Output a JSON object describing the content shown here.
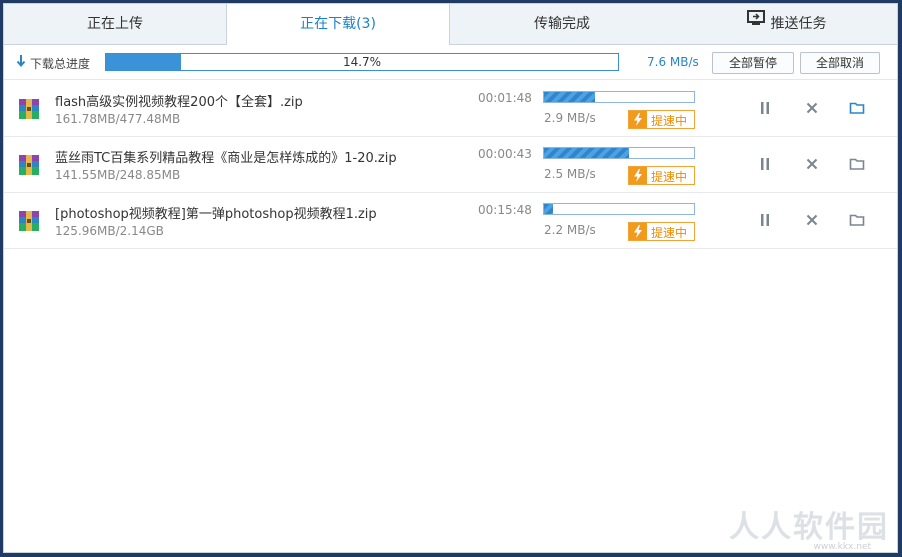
{
  "tabs": [
    {
      "label": "正在上传"
    },
    {
      "label": "正在下载(3)"
    },
    {
      "label": "传输完成"
    },
    {
      "label": "推送任务",
      "icon": "monitor-push-icon"
    }
  ],
  "total": {
    "label": "下载总进度",
    "progress_text": "14.7%",
    "progress": 0.147,
    "speed": "7.6 MB/s",
    "pause_all": "全部暂停",
    "cancel_all": "全部取消"
  },
  "downloads": [
    {
      "name": "flash高级实例视频教程200个【全套】.zip",
      "size": "161.78MB/477.48MB",
      "time": "00:01:48",
      "speed": "2.9 MB/s",
      "progress": 0.339,
      "boost": "提速中"
    },
    {
      "name": "蓝丝雨TC百集系列精品教程《商业是怎样炼成的》1-20.zip",
      "size": "141.55MB/248.85MB",
      "time": "00:00:43",
      "speed": "2.5 MB/s",
      "progress": 0.569,
      "boost": "提速中"
    },
    {
      "name": "[photoshop视频教程]第一弹photoshop视频教程1.zip",
      "size": "125.96MB/2.14GB",
      "time": "00:15:48",
      "speed": "2.2 MB/s",
      "progress": 0.057,
      "boost": "提速中"
    }
  ],
  "watermark": {
    "text": "人人软件园",
    "url": "www.kkx.net"
  },
  "colors": {
    "accent": "#1c7fc9",
    "progress": "#3a93d6",
    "boost": "#f29a1c"
  }
}
